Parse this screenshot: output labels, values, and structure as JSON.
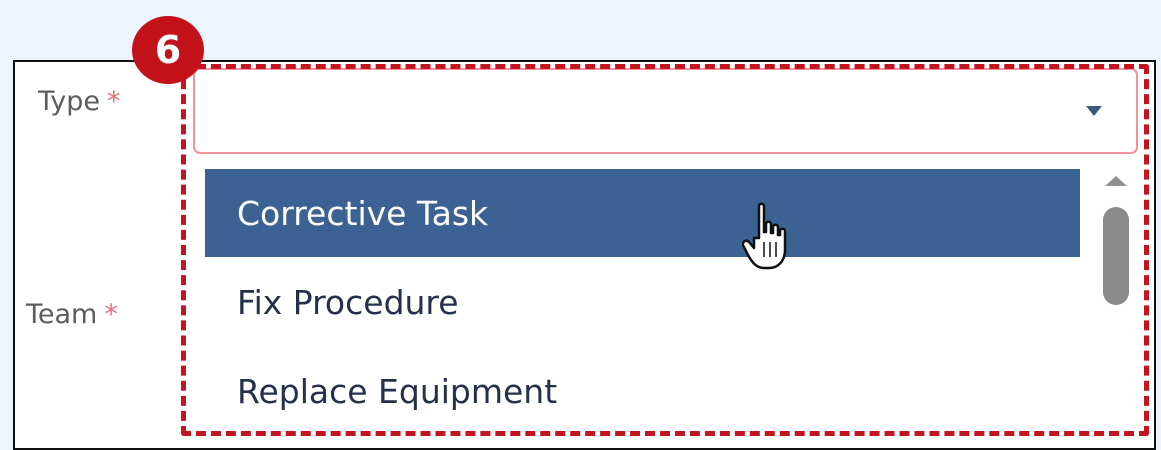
{
  "annotation": {
    "step_number": "6"
  },
  "form": {
    "type_field": {
      "label": "Type",
      "required_marker": "*",
      "value": "",
      "dropdown_icon": "triangle-down-icon"
    },
    "team_field": {
      "label": "Team",
      "required_marker": "*"
    }
  },
  "dropdown": {
    "options": [
      {
        "label": "Corrective Task",
        "state": "hovered"
      },
      {
        "label": "Fix Procedure"
      },
      {
        "label": "Replace Equipment"
      }
    ],
    "scrollbar": {
      "up_icon": "triangle-up-icon"
    }
  },
  "cursor_icon": "hand-pointer-icon",
  "colors": {
    "highlight": "#c41420",
    "selected_option_bg": "#3b6293",
    "required_star": "#e8707a",
    "page_bg": "#edf4fb"
  }
}
